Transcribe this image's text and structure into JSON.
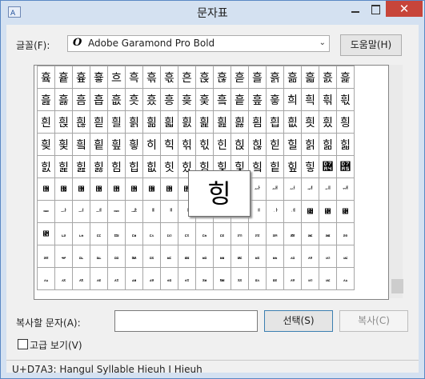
{
  "window": {
    "title": "문자표",
    "close_glyph": "✕"
  },
  "font": {
    "label": "글꼴(F):",
    "type_icon": "O",
    "selected": "Adobe Garamond Pro Bold",
    "arrow": "⌄"
  },
  "buttons": {
    "help": "도움말(H)",
    "select": "선택(S)",
    "copy": "복사(C)"
  },
  "copy_field": {
    "label": "복사할 문자(A):",
    "value": ""
  },
  "advanced": {
    "label": "고급 보기(V)",
    "checked": false
  },
  "magnifier": {
    "char": "힝"
  },
  "status": {
    "text": "U+D7A3: Hangul Syllable Hieuh I Hieuh"
  },
  "grid": {
    "rows": [
      [
        "흌",
        "흍",
        "흎",
        "흏",
        "흐",
        "흑",
        "흒",
        "흓",
        "흔",
        "흕",
        "흖",
        "흗",
        "흘",
        "흙",
        "흚",
        "흛",
        "흜",
        "흝"
      ],
      [
        "흞",
        "흟",
        "흠",
        "흡",
        "흢",
        "흣",
        "흤",
        "흥",
        "흦",
        "흧",
        "흨",
        "흩",
        "흪",
        "흫",
        "희",
        "흭",
        "흮",
        "흯"
      ],
      [
        "흰",
        "흱",
        "흲",
        "흳",
        "흴",
        "흵",
        "흶",
        "흷",
        "흸",
        "흹",
        "흺",
        "흻",
        "흼",
        "흽",
        "흾",
        "흿",
        "힀",
        "힁"
      ],
      [
        "힂",
        "힃",
        "힄",
        "힅",
        "힆",
        "힇",
        "히",
        "힉",
        "힊",
        "힋",
        "힌",
        "힍",
        "힎",
        "힏",
        "힐",
        "힑",
        "힒",
        "힓"
      ],
      [
        "힔",
        "힕",
        "힖",
        "힗",
        "힘",
        "힙",
        "힚",
        "힛",
        "힜",
        "힝",
        "힞",
        "힟",
        "힠",
        "힡",
        "힢",
        "힣",
        "힤",
        "힥"
      ],
      [
        "힦",
        "힧",
        "힨",
        "힩",
        "힪",
        "힫",
        "힬",
        "힭",
        "힮",
        "힯",
        "ힰ",
        "ힱ",
        "ힲ",
        "ힳ",
        "ힴ",
        "ힵ",
        "ힶ",
        "ힷ"
      ],
      [
        "ힸ",
        "ힹ",
        "ힺ",
        "ힻ",
        "ힼ",
        "ힽ",
        "ힾ",
        "ힿ",
        "ퟀ",
        "ퟁ",
        "ퟂ",
        "ퟃ",
        "ퟄ",
        "ퟅ",
        "ퟆ",
        "퟇",
        "퟈",
        "퟉"
      ],
      [
        "퟊",
        "ퟋ",
        "ퟌ",
        "ퟍ",
        "ퟎ",
        "ퟏ",
        "ퟐ",
        "ퟑ",
        "ퟒ",
        "ퟓ",
        "ퟔ",
        "ퟕ",
        "ퟖ",
        "ퟗ",
        "ퟘ",
        "ퟙ",
        "ퟚ",
        "ퟛ"
      ],
      [
        "ퟜ",
        "ퟝ",
        "ퟞ",
        "ퟟ",
        "ퟠ",
        "ퟡ",
        "ퟢ",
        "ퟣ",
        "ퟤ",
        "ퟥ",
        "ퟦ",
        "ퟧ",
        "ퟨ",
        "ퟩ",
        "ퟪ",
        "ퟫ",
        "ퟬ",
        "ퟭ"
      ],
      [
        "ퟮ",
        "ퟯ",
        "ퟰ",
        "ퟱ",
        "ퟲ",
        "ퟳ",
        "ퟴ",
        "ퟵ",
        "ퟶ",
        "ퟷ",
        "ퟸ",
        "ퟹ",
        "ퟺ",
        "ퟻ",
        "ퟫ",
        "ퟬ",
        "ퟭ",
        "ퟮ"
      ]
    ]
  }
}
